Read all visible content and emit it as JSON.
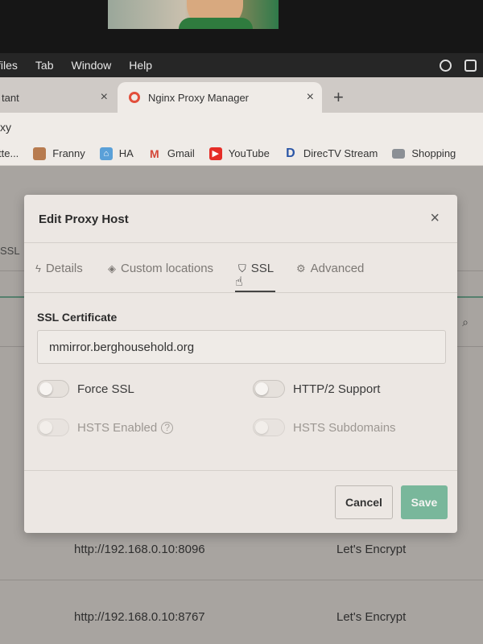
{
  "menubar": {
    "items": [
      "files",
      "Tab",
      "Window",
      "Help"
    ]
  },
  "tabs": [
    {
      "label": "tant",
      "close": "×"
    },
    {
      "label": "Nginx Proxy Manager",
      "close": "×"
    }
  ],
  "new_tab": "+",
  "address_bar": {
    "text": "xy"
  },
  "bookmarks": [
    {
      "label": "tte...",
      "icon": "bookmark-icon"
    },
    {
      "label": "Franny",
      "icon": "franny-icon"
    },
    {
      "label": "HA",
      "icon": "home-assistant-icon"
    },
    {
      "label": "Gmail",
      "icon": "gmail-icon"
    },
    {
      "label": "YouTube",
      "icon": "youtube-icon"
    },
    {
      "label": "DirecTV Stream",
      "icon": "directv-icon"
    },
    {
      "label": "Shopping",
      "icon": "folder-icon"
    }
  ],
  "background": {
    "left_label": "SSL",
    "rows": [
      {
        "destination": "http://192.168.0.10:8096",
        "ssl": "Let's Encrypt"
      },
      {
        "destination": "http://192.168.0.10:8767",
        "ssl": "Let's Encrypt"
      }
    ]
  },
  "modal": {
    "title": "Edit Proxy Host",
    "close": "×",
    "tabs": [
      {
        "label": "Details",
        "icon": "bolt-icon"
      },
      {
        "label": "Custom locations",
        "icon": "layers-icon"
      },
      {
        "label": "SSL",
        "icon": "shield-icon",
        "active": true
      },
      {
        "label": "Advanced",
        "icon": "gear-icon"
      }
    ],
    "ssl_certificate": {
      "label": "SSL Certificate",
      "value": "mmirror.berghousehold.org"
    },
    "toggles": [
      {
        "label": "Force SSL",
        "on": false,
        "disabled": false
      },
      {
        "label": "HTTP/2 Support",
        "on": false,
        "disabled": false
      },
      {
        "label": "HSTS Enabled",
        "on": false,
        "disabled": true
      },
      {
        "label": "HSTS Subdomains",
        "on": false,
        "disabled": true
      }
    ],
    "cancel_label": "Cancel",
    "save_label": "Save"
  },
  "colors": {
    "accent_save": "#79b79b",
    "tab_favicon": "#e24e3b"
  }
}
